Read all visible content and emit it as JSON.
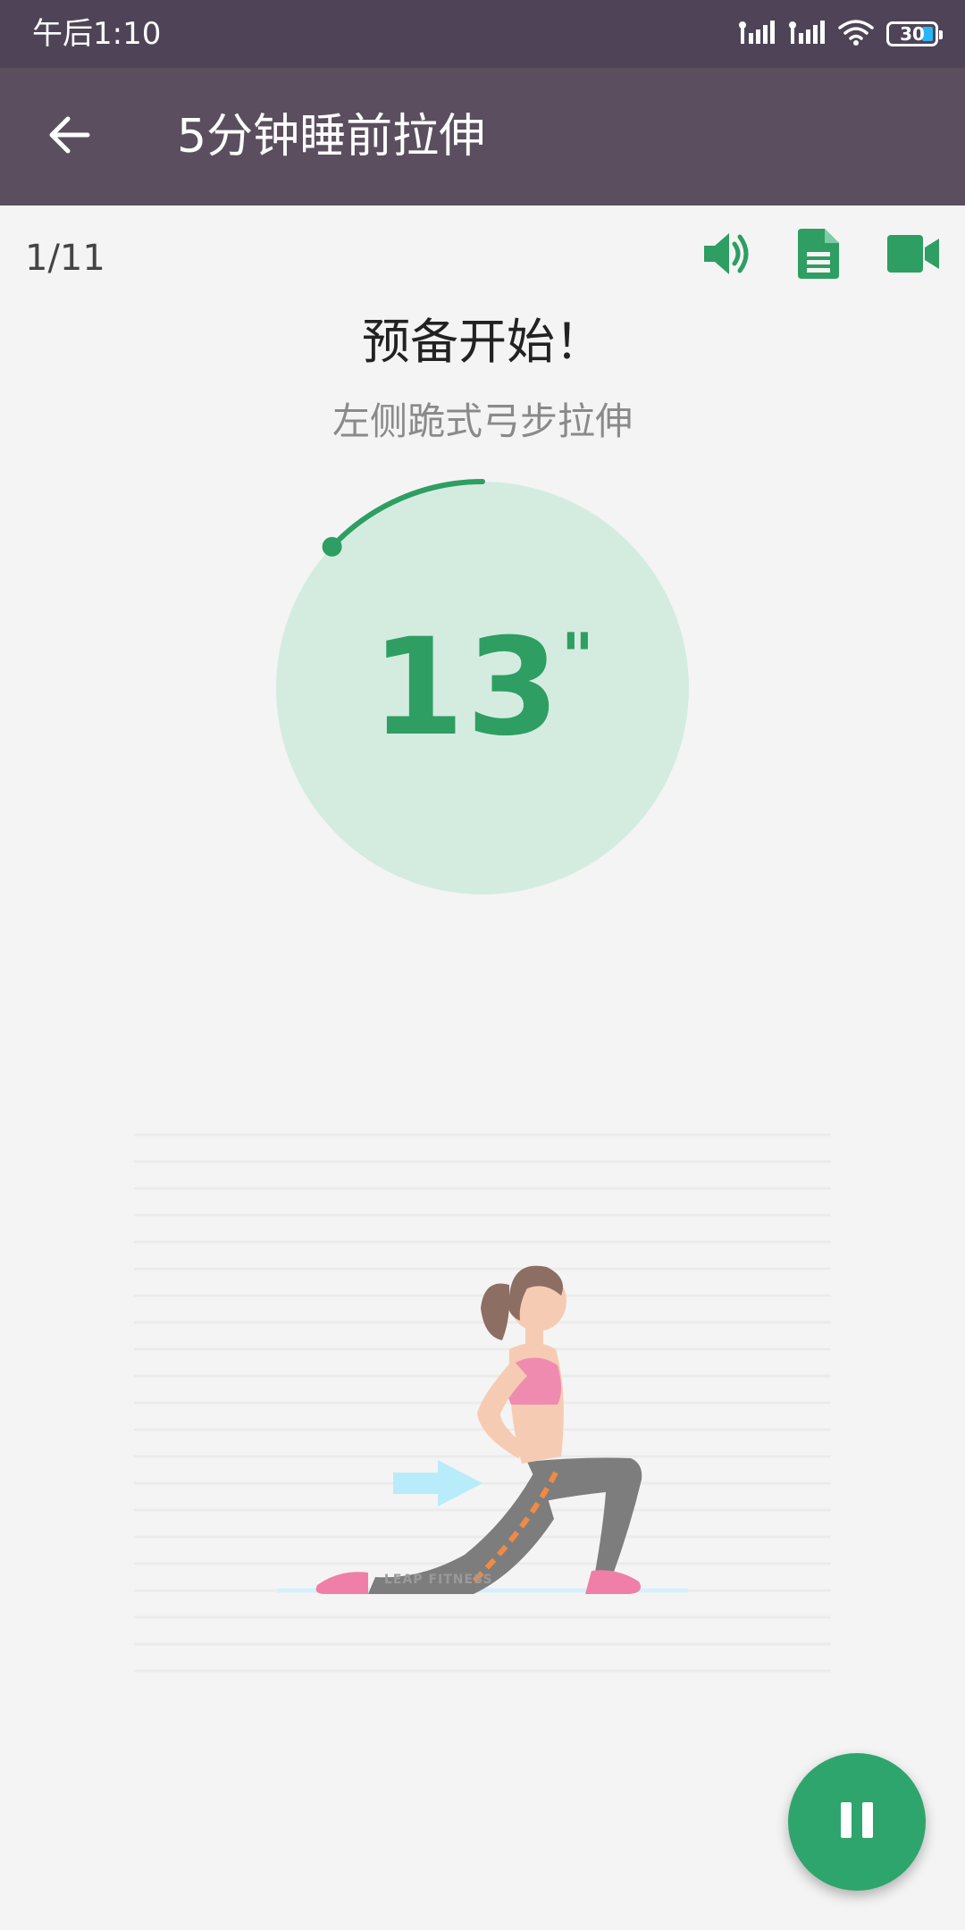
{
  "status_bar": {
    "time": "午后1:10",
    "battery_level": "30",
    "icons": [
      "signal-icon",
      "signal-icon",
      "wifi-icon",
      "battery-icon"
    ]
  },
  "app_bar": {
    "title": "5分钟睡前拉伸",
    "back_icon": "arrow-left-icon"
  },
  "toolbar": {
    "progress": "1/11",
    "icons": [
      "volume-icon",
      "document-icon",
      "video-camera-icon"
    ]
  },
  "exercise": {
    "status_title": "预备开始！",
    "name": "左侧跪式弓步拉伸",
    "countdown_value": "13",
    "countdown_unit": "\"",
    "countdown_progress_fraction": 0.13
  },
  "illustration": {
    "watermark": "LEAP FITNESS"
  },
  "colors": {
    "status_bar_bg": "#4f4457",
    "app_bar_bg": "#5a4e5f",
    "accent_green": "#2ea56c",
    "circle_fill": "#d4ece0",
    "page_bg": "#f4f4f4"
  },
  "controls": {
    "pause_icon": "pause-icon"
  }
}
